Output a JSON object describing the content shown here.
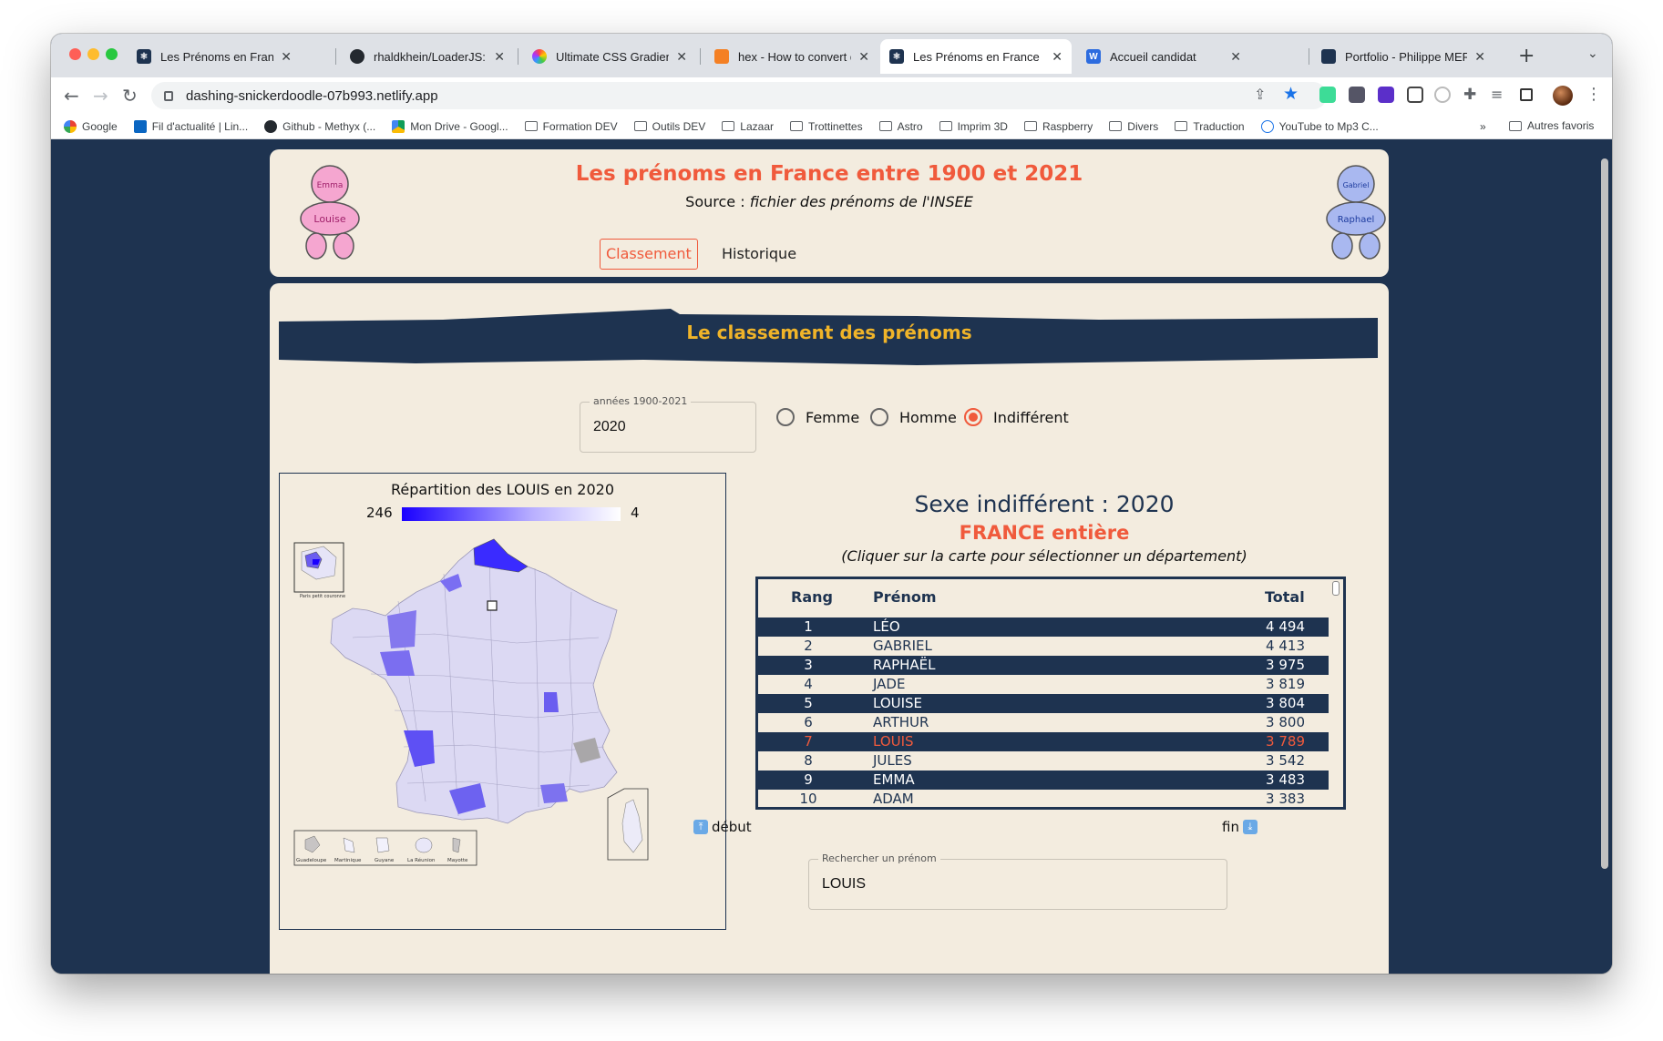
{
  "browser": {
    "tabs": [
      {
        "title": "Les Prénoms en France",
        "active": false
      },
      {
        "title": "rhaldkhein/LoaderJS: A fle",
        "active": false
      },
      {
        "title": "Ultimate CSS Gradient Ge",
        "active": false
      },
      {
        "title": "hex - How to convert deci",
        "active": false
      },
      {
        "title": "Les Prénoms en France",
        "active": true
      },
      {
        "title": "Accueil candidat",
        "active": false
      },
      {
        "title": "Portfolio - Philippe MERCY",
        "active": false
      }
    ],
    "url": "dashing-snickerdoodle-07b993.netlify.app",
    "bookmarks": [
      "Google",
      "Fil d'actualité | Lin...",
      "Github - Methyx (...",
      "Mon Drive - Googl...",
      "Formation DEV",
      "Outils DEV",
      "Lazaar",
      "Trottinettes",
      "Astro",
      "Imprim 3D",
      "Raspberry",
      "Divers",
      "Traduction",
      "YouTube to Mp3 C..."
    ],
    "bookmarks_more": "»",
    "bookmarks_other": "Autres favoris"
  },
  "header": {
    "title": "Les prénoms en France entre 1900 et 2021",
    "source_label": "Source :",
    "source_value": "fichier des prénoms de l'INSEE",
    "nav": [
      "Classement",
      "Historique"
    ]
  },
  "section": {
    "banner": "Le classement des prénoms",
    "year_legend": "années 1900-2021",
    "year_value": "2020",
    "gender_options": [
      "Femme",
      "Homme",
      "Indifférent"
    ],
    "gender_selected": "Indifférent"
  },
  "map": {
    "title": "Répartition des LOUIS en 2020",
    "legend_max": "246",
    "legend_min": "4",
    "inset_paris": "Paris petit couronne",
    "overseas": [
      "Guadeloupe",
      "Martinique",
      "Guyane",
      "La Réunion",
      "Mayotte"
    ]
  },
  "results": {
    "title": "Sexe indifférent : 2020",
    "subtitle": "FRANCE entière",
    "hint": "(Cliquer sur la carte pour sélectionner un département)",
    "columns": [
      "Rang",
      "Prénom",
      "Total"
    ],
    "rows": [
      {
        "rang": "1",
        "prenom": "LÉO",
        "total": "4 494"
      },
      {
        "rang": "2",
        "prenom": "GABRIEL",
        "total": "4 413"
      },
      {
        "rang": "3",
        "prenom": "RAPHAËL",
        "total": "3 975"
      },
      {
        "rang": "4",
        "prenom": "JADE",
        "total": "3 819"
      },
      {
        "rang": "5",
        "prenom": "LOUISE",
        "total": "3 804"
      },
      {
        "rang": "6",
        "prenom": "ARTHUR",
        "total": "3 800"
      },
      {
        "rang": "7",
        "prenom": "LOUIS",
        "total": "3 789"
      },
      {
        "rang": "8",
        "prenom": "JULES",
        "total": "3 542"
      },
      {
        "rang": "9",
        "prenom": "EMMA",
        "total": "3 483"
      },
      {
        "rang": "10",
        "prenom": "ADAM",
        "total": "3 383"
      }
    ],
    "highlight_rank": "7",
    "pager_start": "début",
    "pager_end": "fin",
    "search_legend": "Rechercher un prénom",
    "search_value": "LOUIS"
  },
  "colors": {
    "accent": "#f05a3c",
    "navy": "#1e3350",
    "cream": "#f3ecdf",
    "banner_text": "#f0b429"
  }
}
